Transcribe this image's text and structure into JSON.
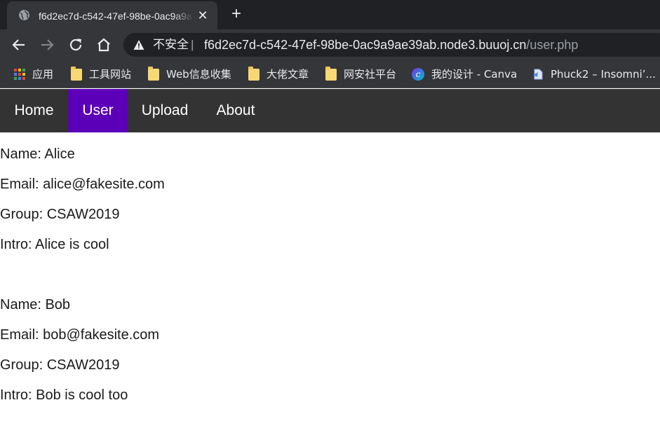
{
  "browser": {
    "tab_title": "f6d2ec7d-c542-47ef-98be-0ac9a9ae39ab.node3.buuoj.cn/user.php",
    "security_label": "不安全",
    "url_host": "f6d2ec7d-c542-47ef-98be-0ac9a9ae39ab.node3.buuoj.cn",
    "url_path": "/user.php",
    "bookmarks": [
      {
        "label": "应用",
        "icon": "apps-grid-icon"
      },
      {
        "label": "工具网站",
        "icon": "folder-icon"
      },
      {
        "label": "Web信息收集",
        "icon": "folder-icon"
      },
      {
        "label": "大佬文章",
        "icon": "folder-icon"
      },
      {
        "label": "网安社平台",
        "icon": "folder-icon"
      },
      {
        "label": "我的设计 - Canva",
        "icon": "canva-icon"
      },
      {
        "label": "Phuck2 – Insomni’...",
        "icon": "page-icon"
      }
    ]
  },
  "navbar": {
    "items": [
      {
        "label": "Home",
        "active": false
      },
      {
        "label": "User",
        "active": true
      },
      {
        "label": "Upload",
        "active": false
      },
      {
        "label": "About",
        "active": false
      }
    ],
    "active_color": "#5b00b8"
  },
  "users": [
    {
      "name": "Name: Alice",
      "email": "Email: alice@fakesite.com",
      "group": "Group: CSAW2019",
      "intro": "Intro: Alice is cool"
    },
    {
      "name": "Name: Bob",
      "email": "Email: bob@fakesite.com",
      "group": "Group: CSAW2019",
      "intro": "Intro: Bob is cool too"
    }
  ]
}
